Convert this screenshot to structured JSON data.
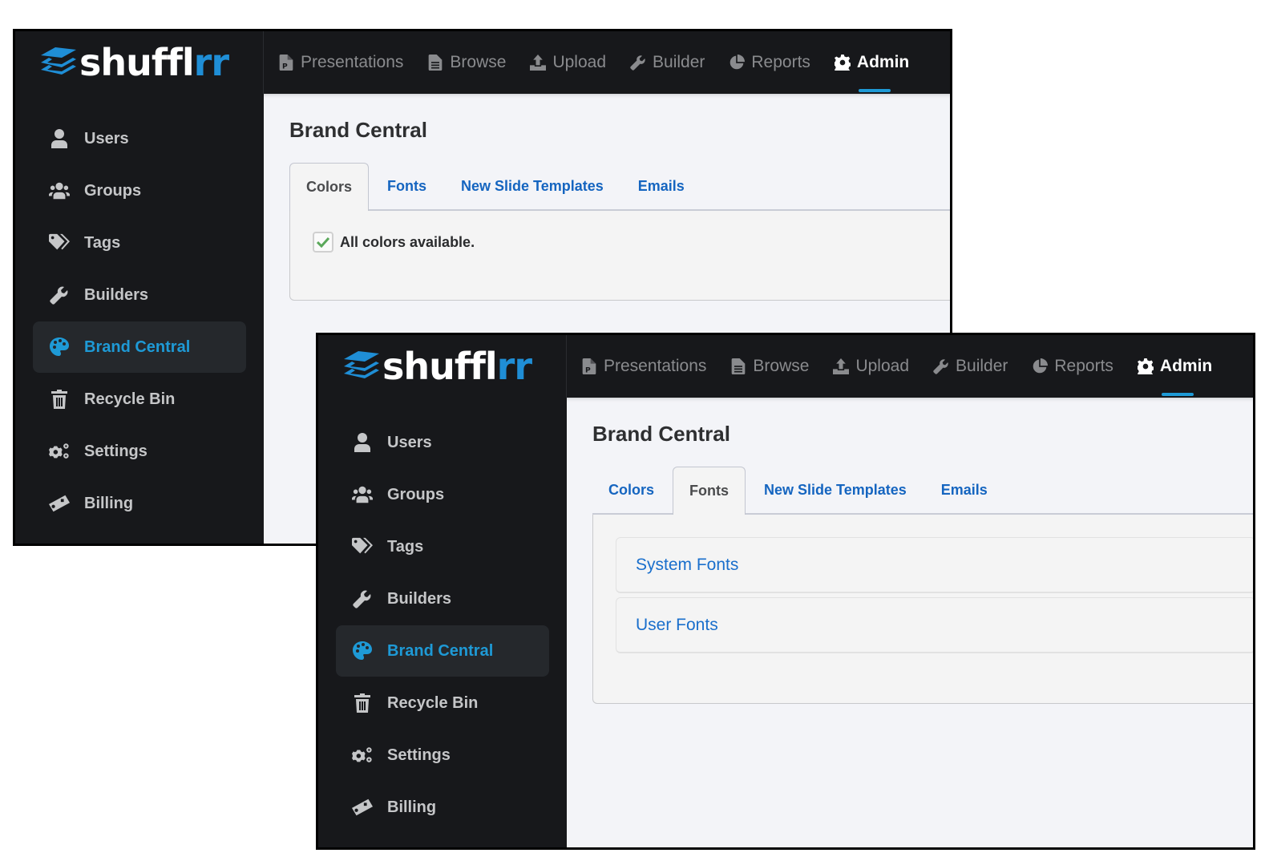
{
  "brand": {
    "logo_main": "shuffl",
    "logo_accent": "rr",
    "accent_color": "#1e9ad6",
    "link_color": "#1565c0"
  },
  "nav": {
    "items": [
      {
        "label": "Presentations",
        "icon": "presentation-file-icon"
      },
      {
        "label": "Browse",
        "icon": "document-icon"
      },
      {
        "label": "Upload",
        "icon": "upload-icon"
      },
      {
        "label": "Builder",
        "icon": "wrench-icon"
      },
      {
        "label": "Reports",
        "icon": "pie-chart-icon"
      },
      {
        "label": "Admin",
        "icon": "gear-icon",
        "active": true
      }
    ]
  },
  "sidebar": {
    "items": [
      {
        "label": "Users",
        "icon": "user-icon"
      },
      {
        "label": "Groups",
        "icon": "users-icon"
      },
      {
        "label": "Tags",
        "icon": "tags-icon"
      },
      {
        "label": "Builders",
        "icon": "wrench-icon"
      },
      {
        "label": "Brand Central",
        "icon": "palette-icon",
        "active": true
      },
      {
        "label": "Recycle Bin",
        "icon": "trash-icon"
      },
      {
        "label": "Settings",
        "icon": "cogs-icon"
      },
      {
        "label": "Billing",
        "icon": "money-bill-icon"
      }
    ]
  },
  "windows": [
    {
      "page_title": "Brand Central",
      "tabs": [
        "Colors",
        "Fonts",
        "New Slide Templates",
        "Emails"
      ],
      "active_tab": "Colors",
      "colors_panel": {
        "checkbox_checked": true,
        "checkbox_label": "All colors available."
      }
    },
    {
      "page_title": "Brand Central",
      "tabs": [
        "Colors",
        "Fonts",
        "New Slide Templates",
        "Emails"
      ],
      "active_tab": "Fonts",
      "fonts_panel": {
        "sections": [
          "System Fonts",
          "User Fonts"
        ]
      }
    }
  ]
}
